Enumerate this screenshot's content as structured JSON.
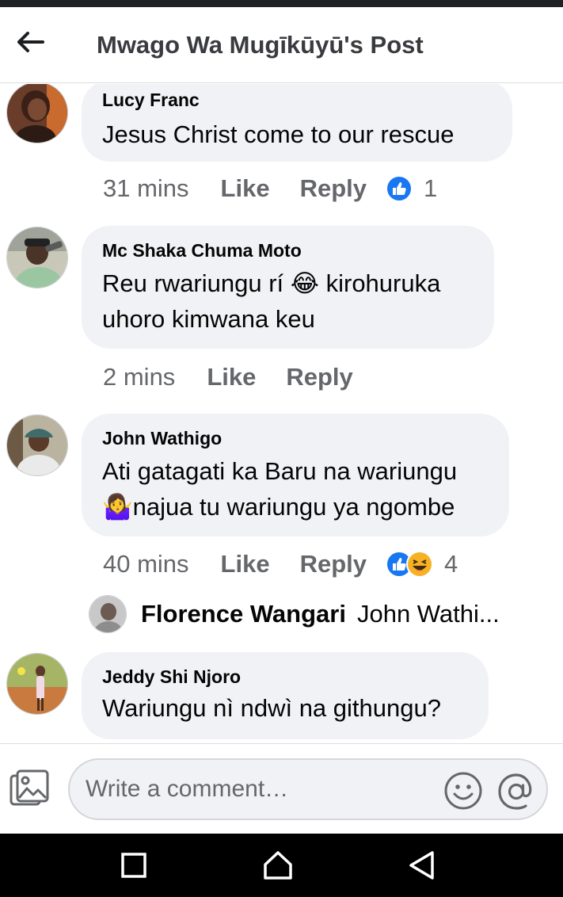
{
  "header": {
    "title": "Mwago Wa Mugīkūyū's Post"
  },
  "comments": [
    {
      "author": "Lucy Franc",
      "lines": [
        "Jesus Christ come to our rescue"
      ],
      "time": "31 mins",
      "like_label": "Like",
      "reply_label": "Reply",
      "reactions": [
        "like"
      ],
      "reaction_count": "1"
    },
    {
      "author": "Mc Shaka Chuma Moto",
      "lines": [
        "Reu rwariungu rí 😂 kirohuruka",
        "uhoro kimwana keu"
      ],
      "time": "2 mins",
      "like_label": "Like",
      "reply_label": "Reply"
    },
    {
      "author": "John Wathigo",
      "lines": [
        "Ati gatagati ka Baru na wariungu",
        "🤷‍♀️najua tu wariungu ya ngombe"
      ],
      "time": "40 mins",
      "like_label": "Like",
      "reply_label": "Reply",
      "reactions": [
        "like",
        "haha"
      ],
      "reaction_count": "4",
      "reply_preview": {
        "author": "Florence Wangari",
        "text": "John Wathi..."
      }
    },
    {
      "author": "Jeddy Shi Njoro",
      "lines": [
        "Wariungu nì ndwì na githungu?"
      ]
    }
  ],
  "composer": {
    "placeholder": "Write a comment…",
    "icons": [
      "photo-icon",
      "emoji-icon",
      "mention-icon"
    ]
  },
  "navigation": {
    "icons": [
      "recent-apps-icon",
      "home-icon",
      "back-triangle-icon"
    ]
  },
  "colors": {
    "bubble": "#f0f2f5",
    "secondary_text": "#65676b",
    "like_blue": "#1877f2",
    "haha_yellow": "#f7b125"
  }
}
